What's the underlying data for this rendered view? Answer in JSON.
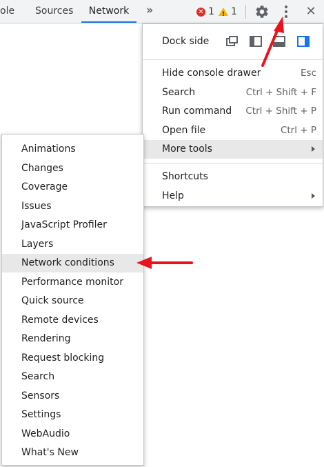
{
  "tabs": [
    {
      "label": "ole",
      "active": false
    },
    {
      "label": "Sources",
      "active": false
    },
    {
      "label": "Network",
      "active": true
    }
  ],
  "toolbar": {
    "overflow_label": "»",
    "error_count": "1",
    "warning_count": "1",
    "error_icon": "error-icon",
    "warning_icon": "warning-icon",
    "settings_icon": "gear-icon",
    "menu_icon": "kebab-menu-icon",
    "close_label": "✕"
  },
  "main_menu": {
    "dock_side_label": "Dock side",
    "dock_icons": [
      "undock-icon",
      "dock-left-icon",
      "dock-bottom-icon",
      "dock-right-icon"
    ],
    "items": [
      {
        "label": "Hide console drawer",
        "shortcut": "Esc"
      },
      {
        "label": "Search",
        "shortcut": "Ctrl + Shift + F"
      },
      {
        "label": "Run command",
        "shortcut": "Ctrl + Shift + P"
      },
      {
        "label": "Open file",
        "shortcut": "Ctrl + P"
      },
      {
        "label": "More tools",
        "shortcut": "",
        "submenu": true,
        "highlighted": true
      }
    ],
    "bottom_items": [
      {
        "label": "Shortcuts"
      },
      {
        "label": "Help",
        "submenu": true
      }
    ]
  },
  "more_tools_menu": {
    "items": [
      "Animations",
      "Changes",
      "Coverage",
      "Issues",
      "JavaScript Profiler",
      "Layers",
      "Network conditions",
      "Performance monitor",
      "Quick source",
      "Remote devices",
      "Rendering",
      "Request blocking",
      "Search",
      "Sensors",
      "Settings",
      "WebAudio",
      "What's New"
    ],
    "highlighted_item": "Network conditions"
  },
  "colors": {
    "accent_blue": "#1a73e8",
    "annotation_red": "#e8141b",
    "error_red": "#d93025",
    "warning_yellow": "#f2b600"
  }
}
